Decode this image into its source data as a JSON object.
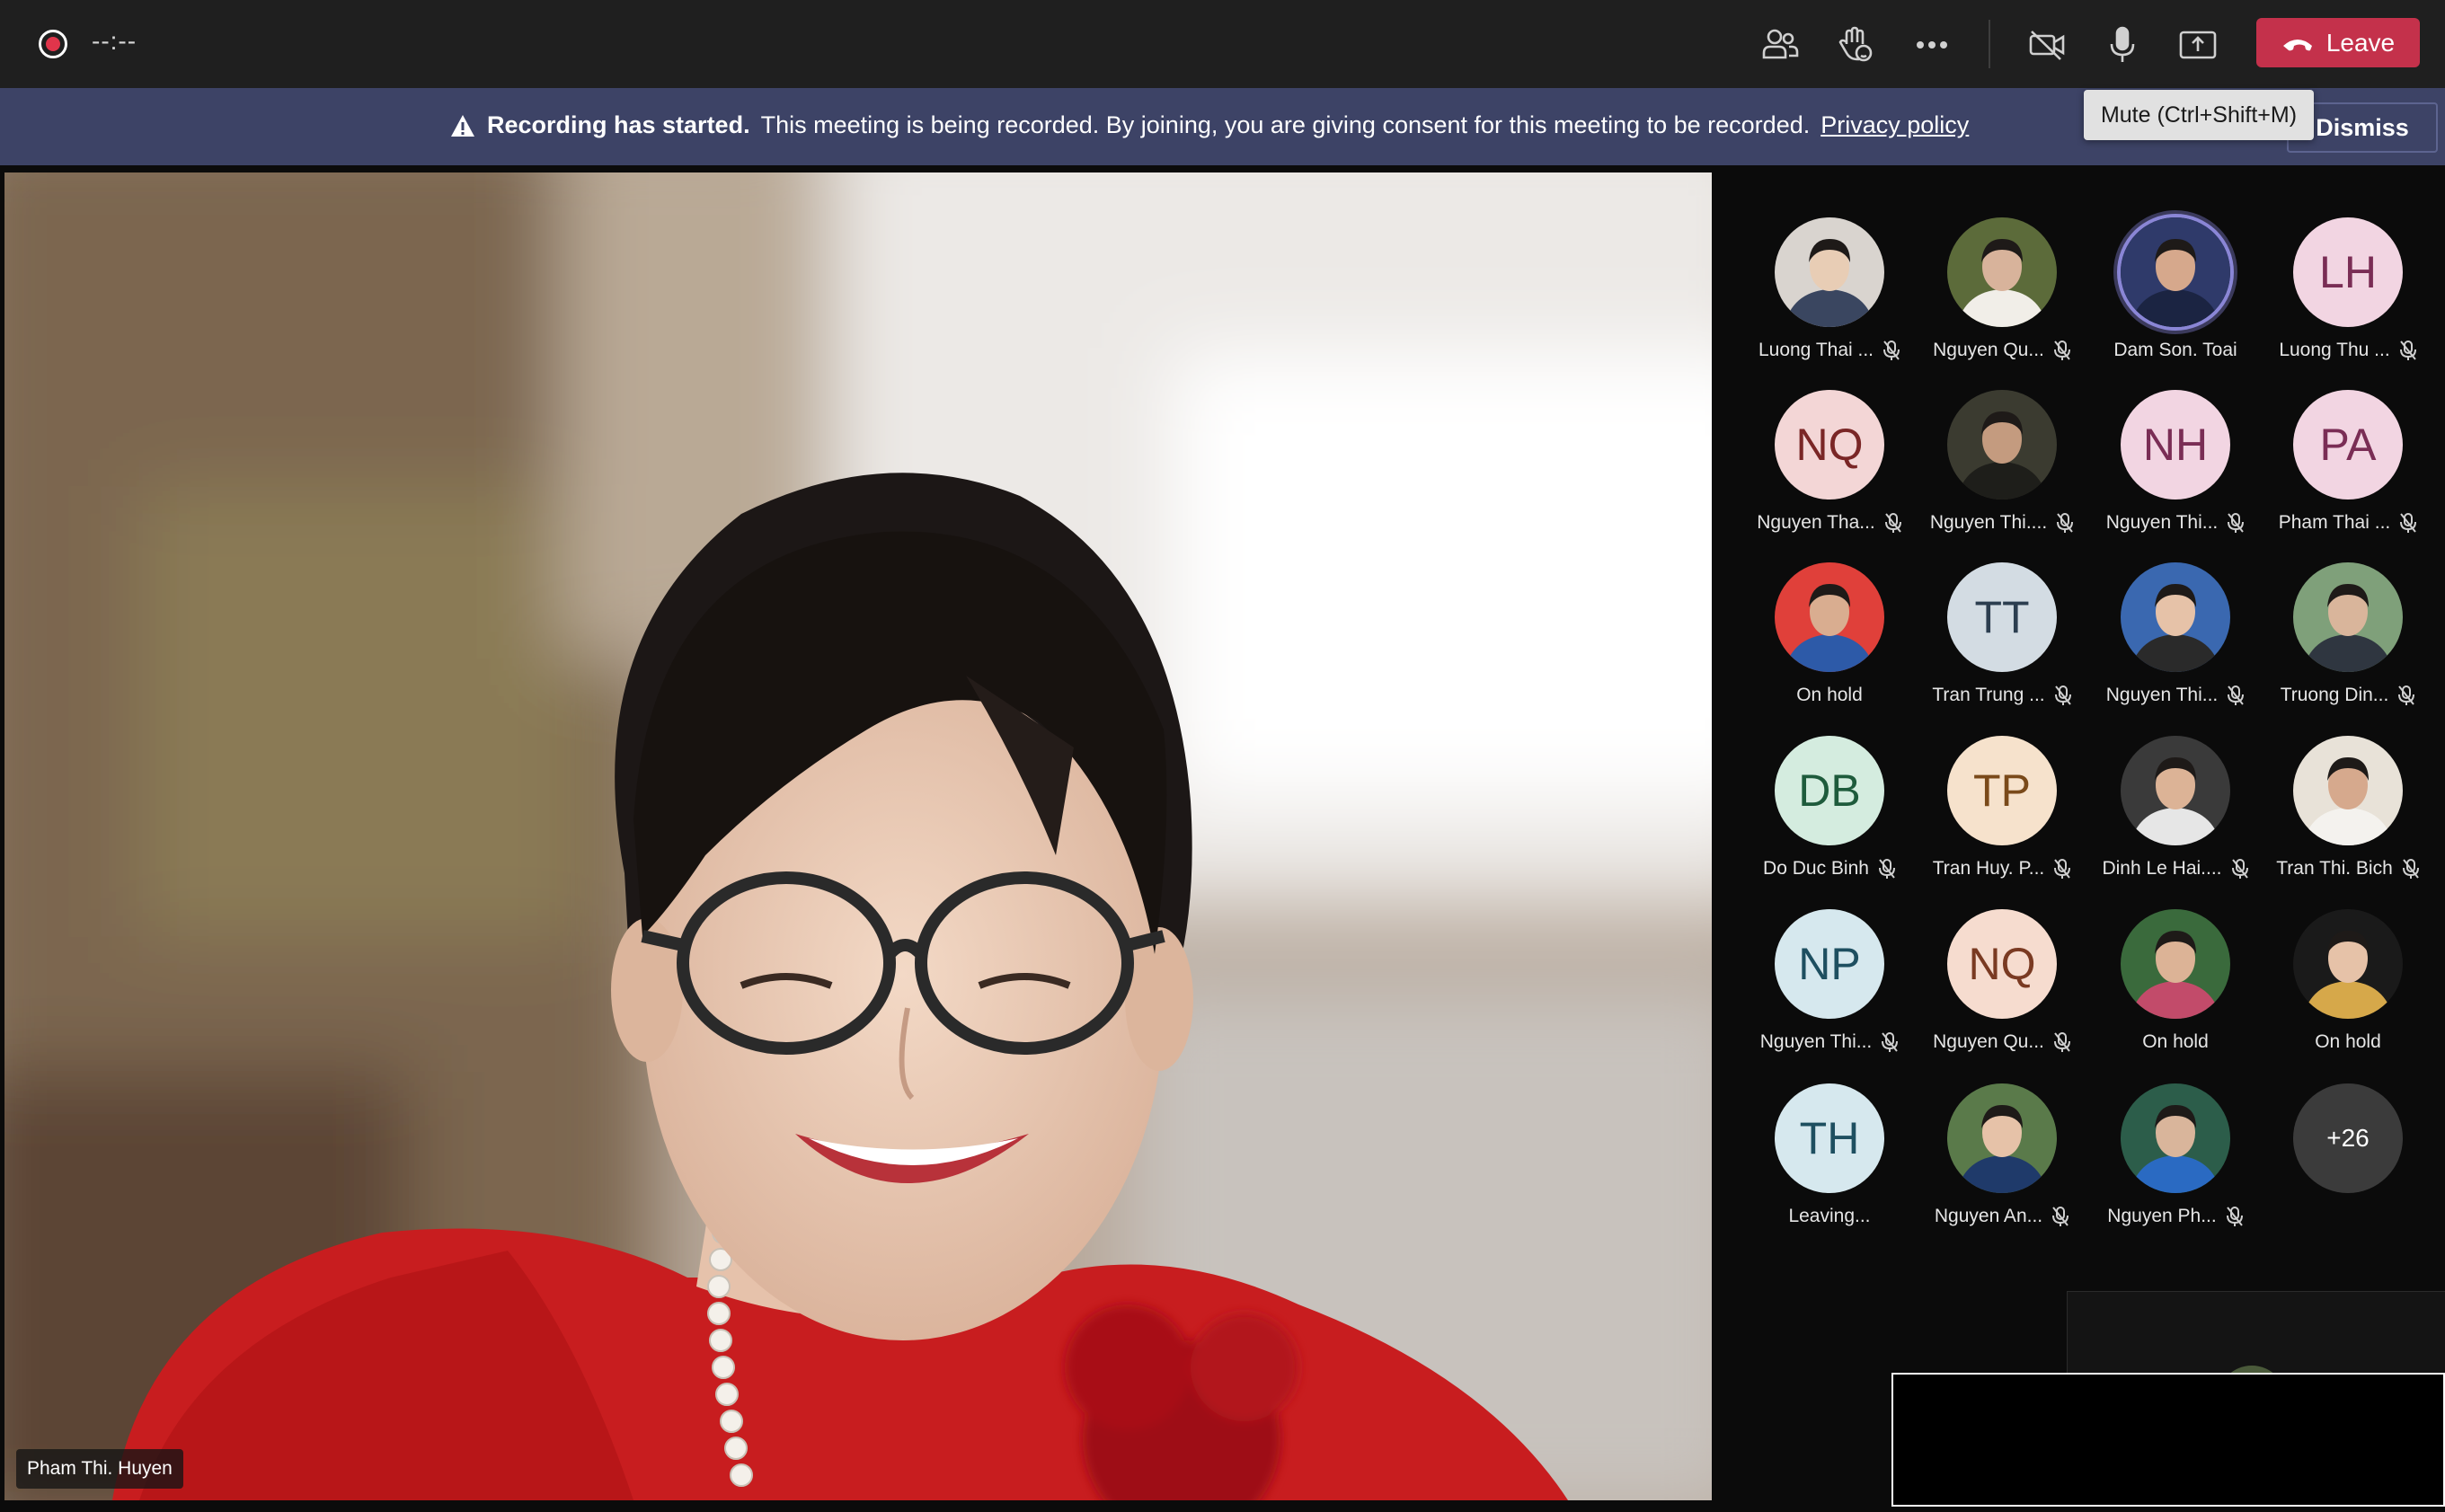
{
  "topbar": {
    "timer": "--:--",
    "icons": [
      "record-icon",
      "people-icon",
      "raise-hand-icon",
      "more-icon",
      "camera-off-icon",
      "mic-icon",
      "share-icon"
    ],
    "leave_label": "Leave"
  },
  "banner": {
    "title": "Recording has started.",
    "message": "This meeting is being recorded. By joining, you are giving consent for this meeting to be recorded.",
    "link": "Privacy policy",
    "dismiss_label": "Dismiss"
  },
  "tooltip": "Mute (Ctrl+Shift+M)",
  "main_video": {
    "speaker_name": "Pham Thi. Huyen"
  },
  "participants": [
    {
      "name": "Luong Thai ...",
      "avatar": "photo",
      "muted": true
    },
    {
      "name": "Nguyen Qu...",
      "avatar": "photo",
      "muted": true
    },
    {
      "name": "Dam Son. Toai",
      "avatar": "photo",
      "muted": false,
      "speaking": true
    },
    {
      "name": "Luong Thu ...",
      "initials": "LH",
      "muted": true,
      "bg": "#f2d5e2",
      "fg": "#7a2d55"
    },
    {
      "name": "Nguyen Tha...",
      "initials": "NQ",
      "muted": true,
      "bg": "#f3d6d6",
      "fg": "#7a2626"
    },
    {
      "name": "Nguyen Thi....",
      "avatar": "photo",
      "muted": true
    },
    {
      "name": "Nguyen Thi...",
      "initials": "NH",
      "muted": true,
      "bg": "#f2d5e2",
      "fg": "#7a2d55"
    },
    {
      "name": "Pham Thai ...",
      "initials": "PA",
      "muted": true,
      "bg": "#f2d5e2",
      "fg": "#7a2d55"
    },
    {
      "name": "On hold",
      "avatar": "photo",
      "muted": false
    },
    {
      "name": "Tran Trung ...",
      "initials": "TT",
      "muted": true,
      "bg": "#d3dce3",
      "fg": "#2c3e50"
    },
    {
      "name": "Nguyen Thi...",
      "avatar": "photo",
      "muted": true
    },
    {
      "name": "Truong Din...",
      "avatar": "photo",
      "muted": true
    },
    {
      "name": "Do Duc Binh",
      "initials": "DB",
      "muted": true,
      "bg": "#d4ecdf",
      "fg": "#1e5b3c"
    },
    {
      "name": "Tran Huy. P...",
      "initials": "TP",
      "muted": true,
      "bg": "#f6e2cc",
      "fg": "#7a4a1a"
    },
    {
      "name": "Dinh Le Hai....",
      "avatar": "photo",
      "muted": true
    },
    {
      "name": "Tran Thi. Bich",
      "avatar": "photo",
      "muted": true
    },
    {
      "name": "Nguyen Thi...",
      "initials": "NP",
      "muted": true,
      "bg": "#d6e8ee",
      "fg": "#1e4f60"
    },
    {
      "name": "Nguyen Qu...",
      "initials": "NQ",
      "muted": true,
      "bg": "#f6dccf",
      "fg": "#7a3a22"
    },
    {
      "name": "On hold",
      "avatar": "photo",
      "muted": false
    },
    {
      "name": "On hold",
      "avatar": "photo",
      "muted": false
    },
    {
      "name": "Leaving...",
      "initials": "TH",
      "muted": false,
      "bg": "#d6e8ee",
      "fg": "#1e4f60"
    },
    {
      "name": "Nguyen An...",
      "avatar": "photo",
      "muted": true
    },
    {
      "name": "Nguyen Ph...",
      "avatar": "photo",
      "muted": true
    }
  ],
  "overflow_count": "+26",
  "colors": {
    "topbar": "#1f1f1f",
    "banner": "#3d4366",
    "leave": "#c4314b",
    "record": "#e0354b"
  }
}
